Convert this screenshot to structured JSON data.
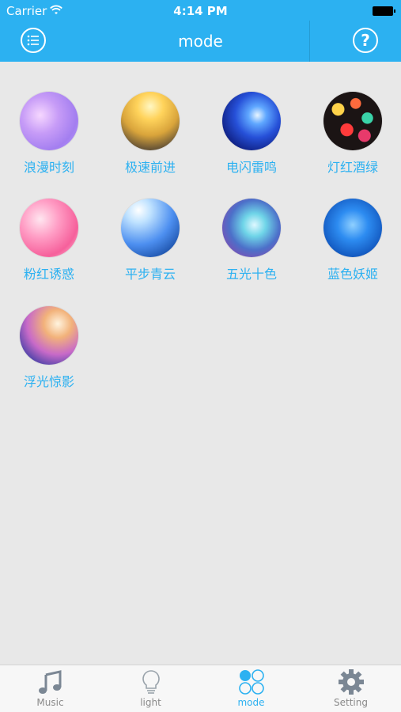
{
  "status_bar": {
    "carrier": "Carrier",
    "time": "4:14 PM"
  },
  "header": {
    "title": "mode",
    "left_icon": "list-icon",
    "right_icon": "help-icon",
    "right_glyph": "?"
  },
  "modes": [
    {
      "label": "浪漫时刻",
      "image": "romance"
    },
    {
      "label": "极速前进",
      "image": "speed-road"
    },
    {
      "label": "电闪雷鸣",
      "image": "lightning"
    },
    {
      "label": "灯红酒绿",
      "image": "bokeh-lights"
    },
    {
      "label": "粉红诱惑",
      "image": "pink"
    },
    {
      "label": "平步青云",
      "image": "sky-stairs"
    },
    {
      "label": "五光十色",
      "image": "colorful"
    },
    {
      "label": "蓝色妖姬",
      "image": "blue-flower"
    },
    {
      "label": "浮光惊影",
      "image": "floating-light"
    }
  ],
  "tabbar": {
    "tabs": [
      {
        "label": "Music",
        "icon": "music-icon",
        "active": false
      },
      {
        "label": "light",
        "icon": "bulb-icon",
        "active": false
      },
      {
        "label": "mode",
        "icon": "mode-icon",
        "active": true
      },
      {
        "label": "Setting",
        "icon": "gear-icon",
        "active": false
      }
    ]
  },
  "colors": {
    "accent": "#2cb1f1",
    "background": "#e8e8e8",
    "tab_inactive": "#8a8a8a"
  }
}
